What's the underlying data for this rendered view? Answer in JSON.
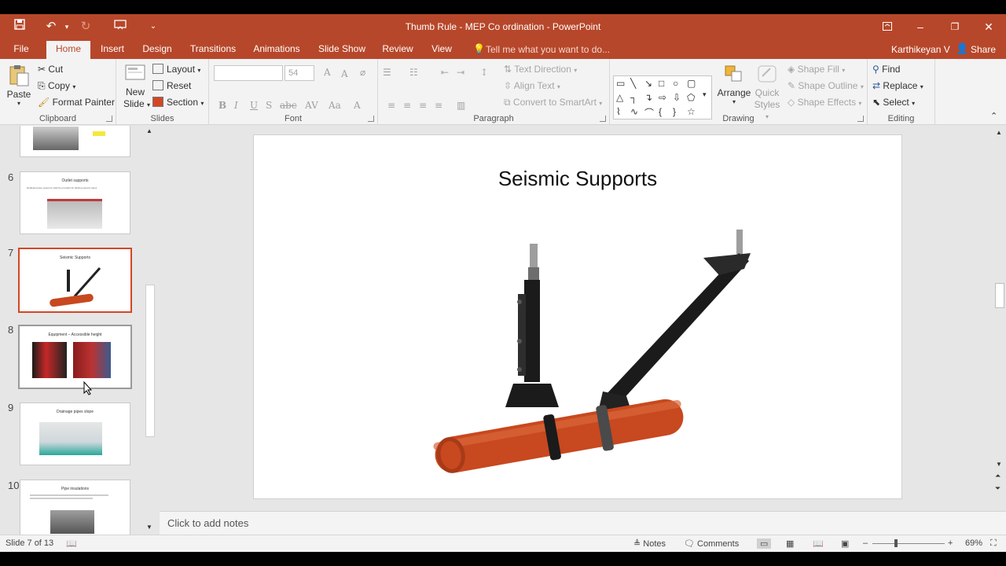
{
  "titlebar": {
    "title": "Thumb Rule - MEP Co ordination - PowerPoint"
  },
  "tabs": {
    "items": [
      "File",
      "Home",
      "Insert",
      "Design",
      "Transitions",
      "Animations",
      "Slide Show",
      "Review",
      "View"
    ],
    "tell_me": "Tell me what you want to do...",
    "user": "Karthikeyan V",
    "share": "Share"
  },
  "ribbon": {
    "clipboard": {
      "label": "Clipboard",
      "paste": "Paste",
      "cut": "Cut",
      "copy": "Copy",
      "format_painter": "Format Painter"
    },
    "slides": {
      "label": "Slides",
      "new_slide_1": "New",
      "new_slide_2": "Slide",
      "layout": "Layout",
      "reset": "Reset",
      "section": "Section"
    },
    "font": {
      "label": "Font",
      "size": "54"
    },
    "paragraph": {
      "label": "Paragraph",
      "text_direction": "Text Direction",
      "align_text": "Align Text",
      "convert_smartart": "Convert to SmartArt"
    },
    "drawing": {
      "label": "Drawing",
      "arrange": "Arrange",
      "quick_1": "Quick",
      "quick_2": "Styles",
      "shape_fill": "Shape Fill",
      "shape_outline": "Shape Outline",
      "shape_effects": "Shape Effects"
    },
    "editing": {
      "label": "Editing",
      "find": "Find",
      "replace": "Replace",
      "select": "Select"
    }
  },
  "thumbnails": [
    {
      "num": "6",
      "title": "Outlet supports",
      "sub": "Dedicated pipe supports shall be provided for lighting seismic pipes"
    },
    {
      "num": "7",
      "title": "Seismic Supports",
      "sub": ""
    },
    {
      "num": "8",
      "title": "Equipment – Accessible height",
      "sub": ""
    },
    {
      "num": "9",
      "title": "Drainage pipes slope",
      "sub": ""
    },
    {
      "num": "10",
      "title": "Pipe insulations",
      "sub": ""
    }
  ],
  "slide": {
    "title": "Seismic Supports"
  },
  "notes": {
    "placeholder": "Click to add notes"
  },
  "status": {
    "slide_info": "Slide 7 of 13",
    "notes": "Notes",
    "comments": "Comments",
    "zoom": "69%"
  },
  "colors": {
    "accent": "#b7472a",
    "pipe": "#c8481f"
  }
}
